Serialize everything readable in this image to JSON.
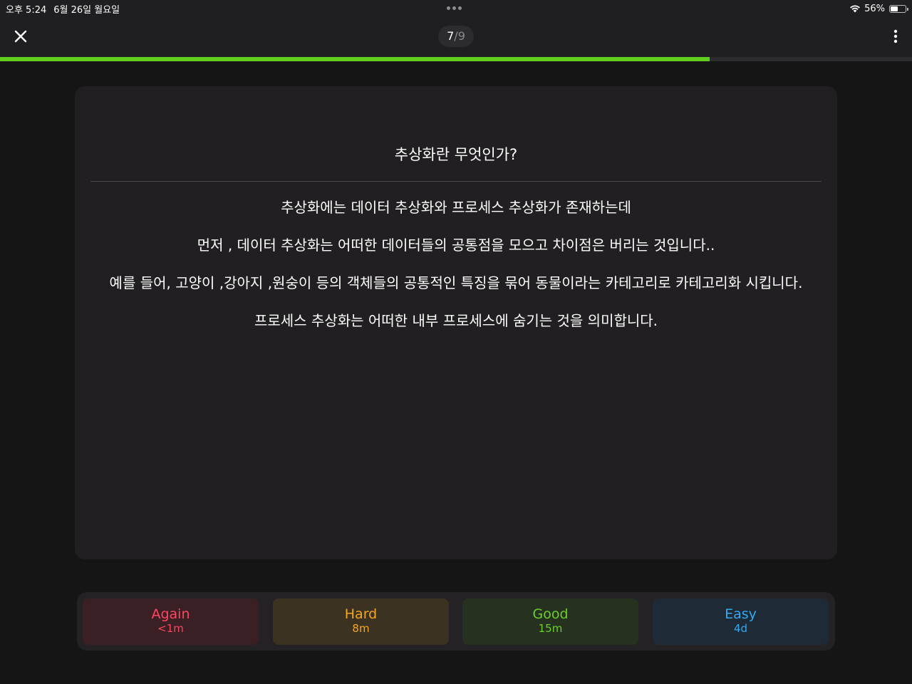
{
  "status_bar": {
    "time": "오후 5:24",
    "date": "6월 26일 월요일",
    "battery_percent_text": "56%",
    "battery_level": 0.56,
    "icons": [
      "wifi-icon",
      "battery-icon",
      "multitasking-dots-icon"
    ]
  },
  "header": {
    "counter_current": "7",
    "counter_separator": "/",
    "counter_total": "9",
    "progress_fraction": 0.778,
    "progress_color": "#5fce1e",
    "icons": [
      "close-icon",
      "more-vertical-icon"
    ]
  },
  "card": {
    "question": "추상화란 무엇인가?",
    "answer_paragraphs": [
      "추상화에는 데이터 추상화와 프로세스 추상화가 존재하는데",
      "먼저 , 데이터 추상화는 어떠한 데이터들의 공통점을 모으고 차이점은 버리는 것입니다..",
      "예를 들어, 고양이 ,강아지 ,원숭이 등의 객체들의 공통적인 특징을 묶어 동물이라는 카테고리로 카테고리화 시킵니다.",
      "프로세스 추상화는 어떠한 내부 프로세스에 숨기는 것을 의미합니다."
    ]
  },
  "answer_buttons": [
    {
      "label": "Again",
      "interval": "<1m",
      "color": "#ff4560"
    },
    {
      "label": "Hard",
      "interval": "8m",
      "color": "#f5a623"
    },
    {
      "label": "Good",
      "interval": "15m",
      "color": "#6ccf2a"
    },
    {
      "label": "Easy",
      "interval": "4d",
      "color": "#33aaf2"
    }
  ]
}
